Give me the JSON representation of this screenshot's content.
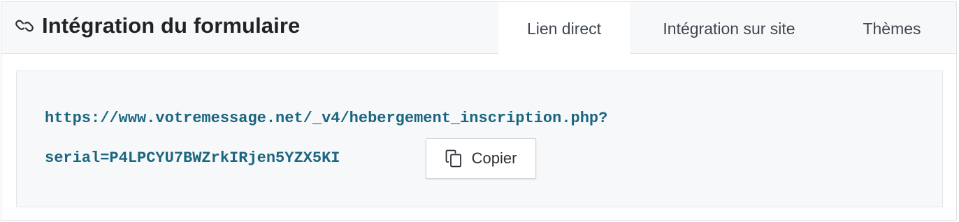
{
  "header": {
    "icon": "link-icon",
    "title": "Intégration du formulaire"
  },
  "tabs": [
    {
      "label": "Lien direct",
      "active": true
    },
    {
      "label": "Intégration sur site",
      "active": false
    },
    {
      "label": "Thèmes",
      "active": false
    }
  ],
  "content": {
    "url_line1": "https://www.votremessage.net/_v4/hebergement_inscription.php?",
    "url_line2": "serial=P4LPCYU7BWZrkIRjen5YZX5KI",
    "copy_button": {
      "icon": "copy-icon",
      "label": "Copier"
    }
  },
  "colors": {
    "link_text": "#1a6680",
    "header_bg": "#f7f8f9",
    "content_bg": "#f7f8f9"
  }
}
